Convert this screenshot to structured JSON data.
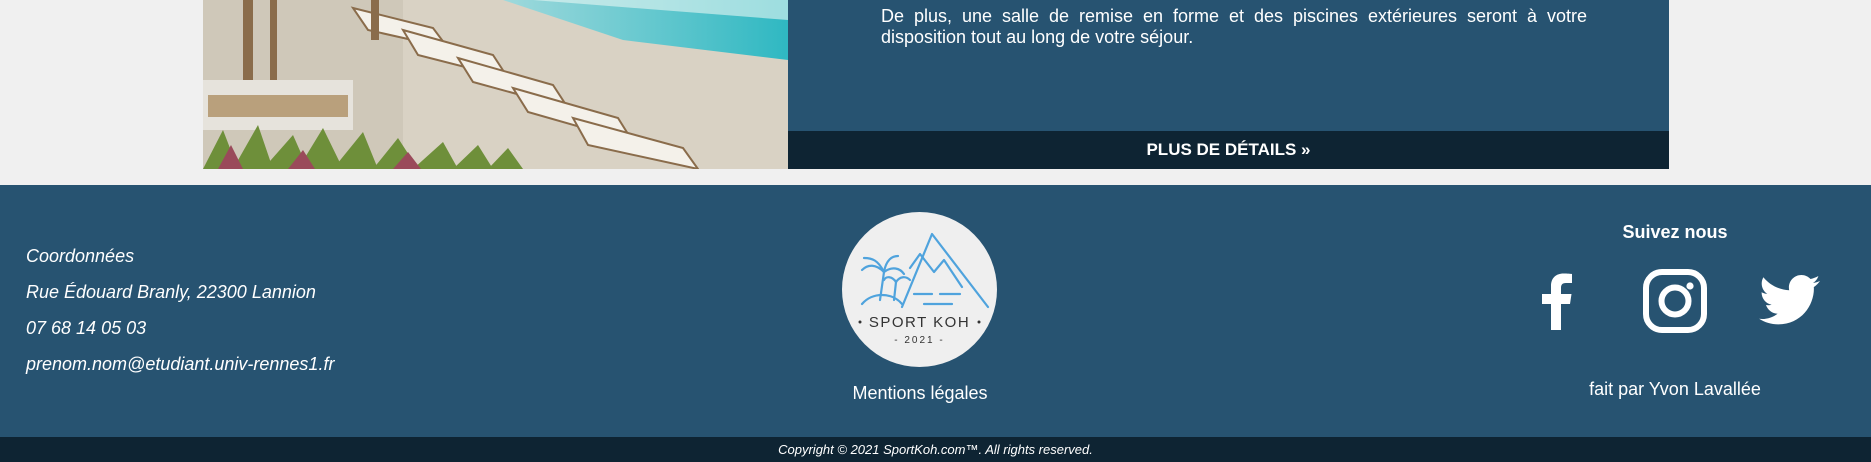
{
  "card": {
    "text": "De plus, une salle de remise en forme et des piscines extérieures seront à votre disposition tout au long de votre séjour.",
    "button_label": "PLUS DE DÉTAILS »",
    "image_alt": "beach-loungers-photo"
  },
  "footer": {
    "contact": {
      "heading": "Coordonnées",
      "address": "Rue Édouard Branly, 22300 Lannion",
      "phone": "07 68 14 05 03",
      "email": "prenom.nom@etudiant.univ-rennes1.fr"
    },
    "logo": {
      "name": "SPORT KOH",
      "year": "- 2021 -"
    },
    "legal_link": "Mentions légales",
    "social": {
      "title": "Suivez nous",
      "icons": [
        "facebook-icon",
        "instagram-icon",
        "twitter-icon"
      ]
    },
    "credit": "fait par Yvon Lavallée"
  },
  "copyright": "Copyright © 2021 SportKoh.com™. All rights reserved.",
  "colors": {
    "page_bg": "#f0f0f0",
    "panel_blue": "#275371",
    "dark_navy": "#0e2433",
    "logo_blue": "#4fa3dd",
    "text": "#ffffff"
  }
}
